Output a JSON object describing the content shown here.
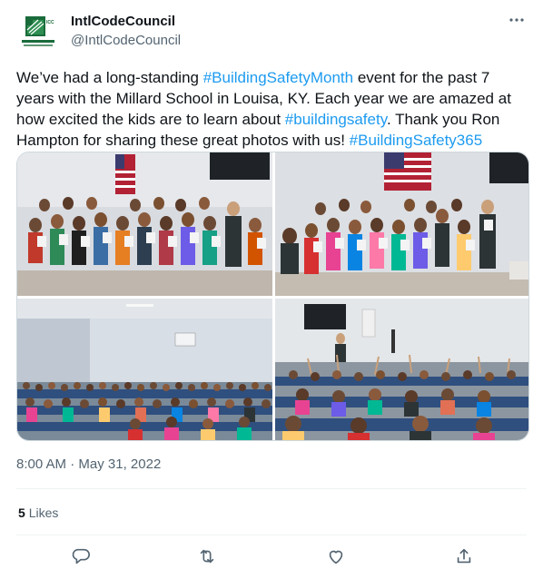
{
  "account": {
    "display_name": "IntlCodeCouncil",
    "handle": "@IntlCodeCouncil",
    "avatar_text": "ICC",
    "avatar_subtext": "INTERNATIONAL CODE COUNCIL"
  },
  "tweet": {
    "segments": [
      {
        "text": "We’ve had a long-standing ",
        "tag": false
      },
      {
        "text": "#BuildingSafetyMonth",
        "tag": true
      },
      {
        "text": " event for the past 7 years with the Millard School in Louisa, KY. Each year we are amazed at how excited the kids are to learn about ",
        "tag": false
      },
      {
        "text": "#buildingsafety",
        "tag": true
      },
      {
        "text": ". Thank you Ron Hampton for sharing these great photos with us! ",
        "tag": false
      },
      {
        "text": "#BuildingSafety365",
        "tag": true
      }
    ]
  },
  "media": {
    "photos": [
      "group-photo-with-certificates-1",
      "group-photo-with-certificates-2",
      "classroom-audience-1",
      "classroom-audience-2"
    ]
  },
  "meta": {
    "time": "8:00 AM",
    "separator": " · ",
    "date": "May 31, 2022"
  },
  "stats": {
    "likes_count": "5",
    "likes_label": "Likes"
  },
  "actions": {
    "icons": [
      "reply-icon",
      "retweet-icon",
      "like-icon",
      "share-icon"
    ]
  },
  "colors": {
    "accent": "#1d9bf0",
    "text": "#0f1419",
    "secondary": "#536471",
    "icc_green": "#1a6b3a"
  }
}
